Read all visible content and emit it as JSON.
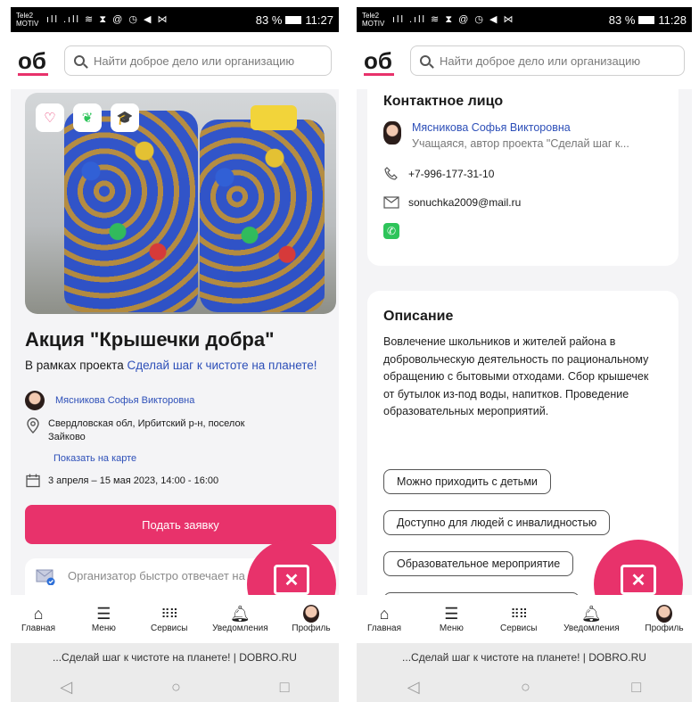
{
  "left": {
    "status": {
      "carrier": "Tele2\nMOTIV",
      "icons": "ıll .ıll ≋ ⧗ @ ◷ ◀ ⋈",
      "battery": "83 %",
      "time": "11:27"
    },
    "header": {
      "logo": "об",
      "search_placeholder": "Найти доброе дело или организацию"
    },
    "badges": [
      "♡",
      "❦",
      "🎓"
    ],
    "title": "Акция \"Крышечки добра\"",
    "project_prefix": "В рамках проекта ",
    "project_link": "Сделай шаг к чистоте на планете!",
    "organizer": "Мясникова Софья Викторовна",
    "address": "Свердловская обл, Ирбитский р-н, поселок Зайково",
    "map_link": "Показать на карте",
    "date": "3 апреля – 15 мая 2023, 14:00 - 16:00",
    "apply_button": "Подать заявку",
    "org_note": "Организатор быстро отвечает на"
  },
  "right": {
    "status": {
      "carrier": "Tele2\nMOTIV",
      "icons": "ıll .ıll ≋ ⧗ @ ◷ ◀ ⋈",
      "battery": "83 %",
      "time": "11:28"
    },
    "header": {
      "logo": "об",
      "search_placeholder": "Найти доброе дело или организацию"
    },
    "contact_title": "Контактное лицо",
    "contact_name": "Мясникова Софья Викторовна",
    "contact_role": "Учащаяся, автор проекта \"Сделай шаг к...",
    "phone": "+7-996-177-31-10",
    "email": "sonuchka2009@mail.ru",
    "desc_title": "Описание",
    "desc_text": "Вовлечение школьников и жителей района в добровольческую деятельность по рациональному обращению с бытовыми отходами. Сбор крышечек от бутылок из-под воды, напитков. Проведение образовательных мероприятий.",
    "tags": [
      "Можно приходить с детьми",
      "Доступно для людей с инвалидностью",
      "Образовательное мероприятие"
    ]
  },
  "nav": {
    "home": "Главная",
    "menu": "Меню",
    "services": "Сервисы",
    "notifications": "Уведомления",
    "profile": "Профиль"
  },
  "urlbar": "...Сделай шаг к чистоте на планете! | DOBRO.RU",
  "sysnav": {
    "back": "◁",
    "home": "○",
    "recent": "□"
  }
}
